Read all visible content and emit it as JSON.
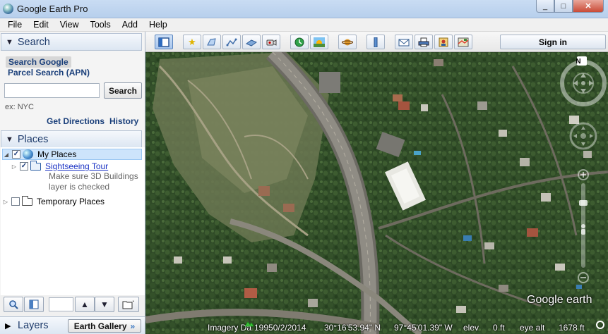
{
  "window": {
    "title": "Google Earth Pro",
    "controls": [
      "_",
      "□",
      "✕"
    ]
  },
  "menu": [
    "File",
    "Edit",
    "View",
    "Tools",
    "Add",
    "Help"
  ],
  "search": {
    "header": "Search",
    "tab_google": "Search Google",
    "tab_parcel": "Parcel Search (APN)",
    "input_value": "",
    "button": "Search",
    "hint": "ex: NYC",
    "get_directions": "Get Directions",
    "history": "History"
  },
  "places": {
    "header": "Places",
    "my_places": "My Places",
    "sightseeing": "Sightseeing Tour",
    "note_line1": "Make sure 3D Buildings",
    "note_line2": "layer is checked",
    "temporary": "Temporary Places"
  },
  "layers": {
    "header": "Layers",
    "gallery": "Earth Gallery",
    "gallery_icon": "double-chevron-right-icon"
  },
  "toolbar": {
    "sign_in": "Sign in",
    "icons": [
      "sidebar-toggle-icon",
      "placemark-icon",
      "polygon-icon",
      "path-icon",
      "overlay-icon",
      "record-tour-icon",
      "historical-imagery-icon",
      "sunlight-icon",
      "planets-icon",
      "ruler-icon",
      "email-icon",
      "print-icon",
      "save-image-icon",
      "view-in-maps-icon"
    ]
  },
  "status": {
    "imagery": "Imagery Da",
    "date": "19950/2/2014",
    "lat": "30°16'53.94\" N",
    "lon": "97°45'01.39\" W",
    "elev_label": "elev",
    "elev_value": "0 ft",
    "eye_label": "eye alt",
    "eye_value": "1678 ft"
  },
  "map": {
    "brand": "Google earth",
    "north_label": "N"
  }
}
